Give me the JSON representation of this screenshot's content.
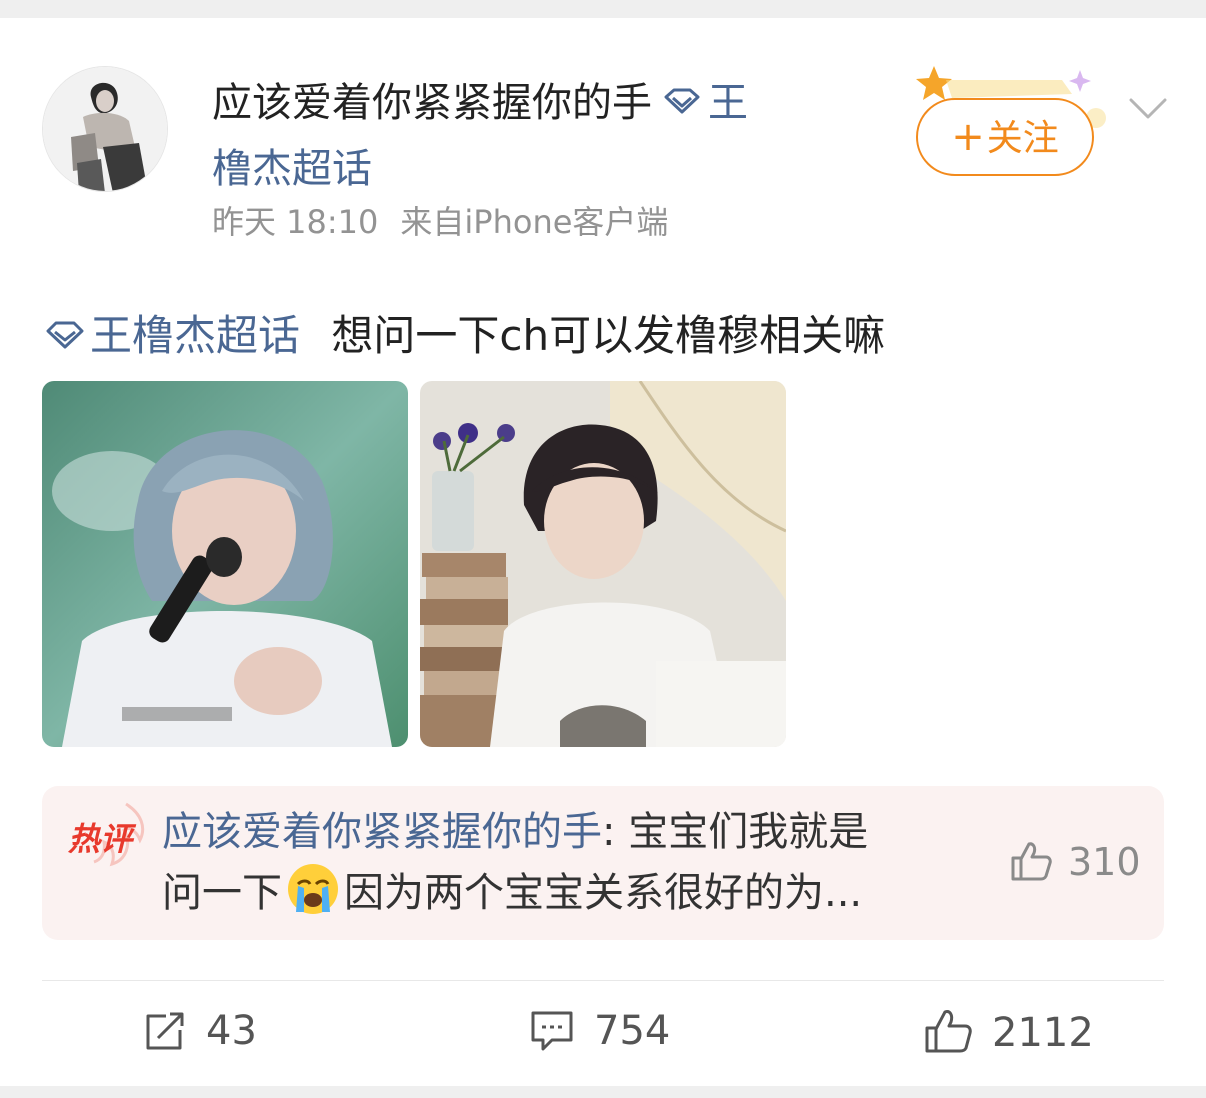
{
  "post": {
    "username": "应该爱着你紧紧握你的手",
    "supertopic_line1": "王",
    "supertopic_line2": "橹杰超话",
    "time": "昨天 18:10",
    "source": "来自iPhone客户端",
    "follow_plus": "+",
    "follow_label": "关注",
    "tag": "王橹杰超话",
    "body": "想问一下ch可以发橹穆相关嘛",
    "images": [
      "photo-1",
      "photo-2"
    ]
  },
  "hot_comment": {
    "badge": "热评",
    "author": "应该爱着你紧紧握你的手",
    "text_part1": ": 宝宝们我就是",
    "text_part2": "问一下",
    "text_part3": "因为两个宝宝关系很好的为...",
    "emoji": "crying-face",
    "likes": "310"
  },
  "actions": {
    "repost": "43",
    "comment": "754",
    "like": "2112"
  },
  "colors": {
    "link": "#4a6793",
    "follow": "#f28a1c",
    "hot_badge": "#e8392c",
    "hot_bg": "#fbf2f1"
  }
}
